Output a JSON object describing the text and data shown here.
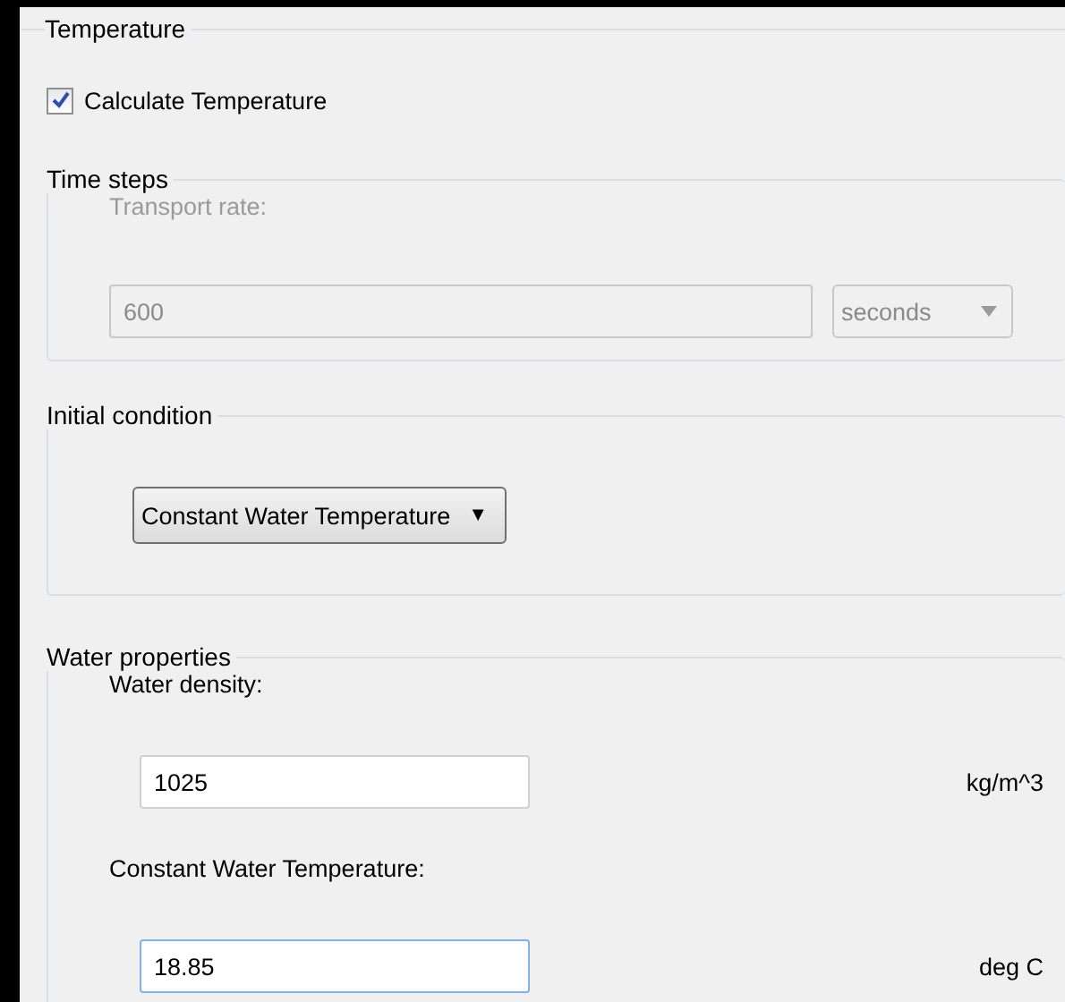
{
  "title": "Temperature",
  "calculate": {
    "label": "Calculate Temperature",
    "checked": true
  },
  "time_steps": {
    "title": "Time steps",
    "disabled": true,
    "label": "Transport rate:",
    "value": "600",
    "unit": "seconds"
  },
  "initial_condition": {
    "title": "Initial condition",
    "value": "Constant Water Temperature",
    "arrow": "▼"
  },
  "water_properties": {
    "title": "Water properties",
    "fields": [
      {
        "label": "Water density:",
        "value": "1025",
        "unit": "kg/m^3",
        "focused": false
      },
      {
        "label": "Constant Water Temperature:",
        "value": "18.85",
        "unit": "deg C",
        "focused": true
      }
    ]
  }
}
